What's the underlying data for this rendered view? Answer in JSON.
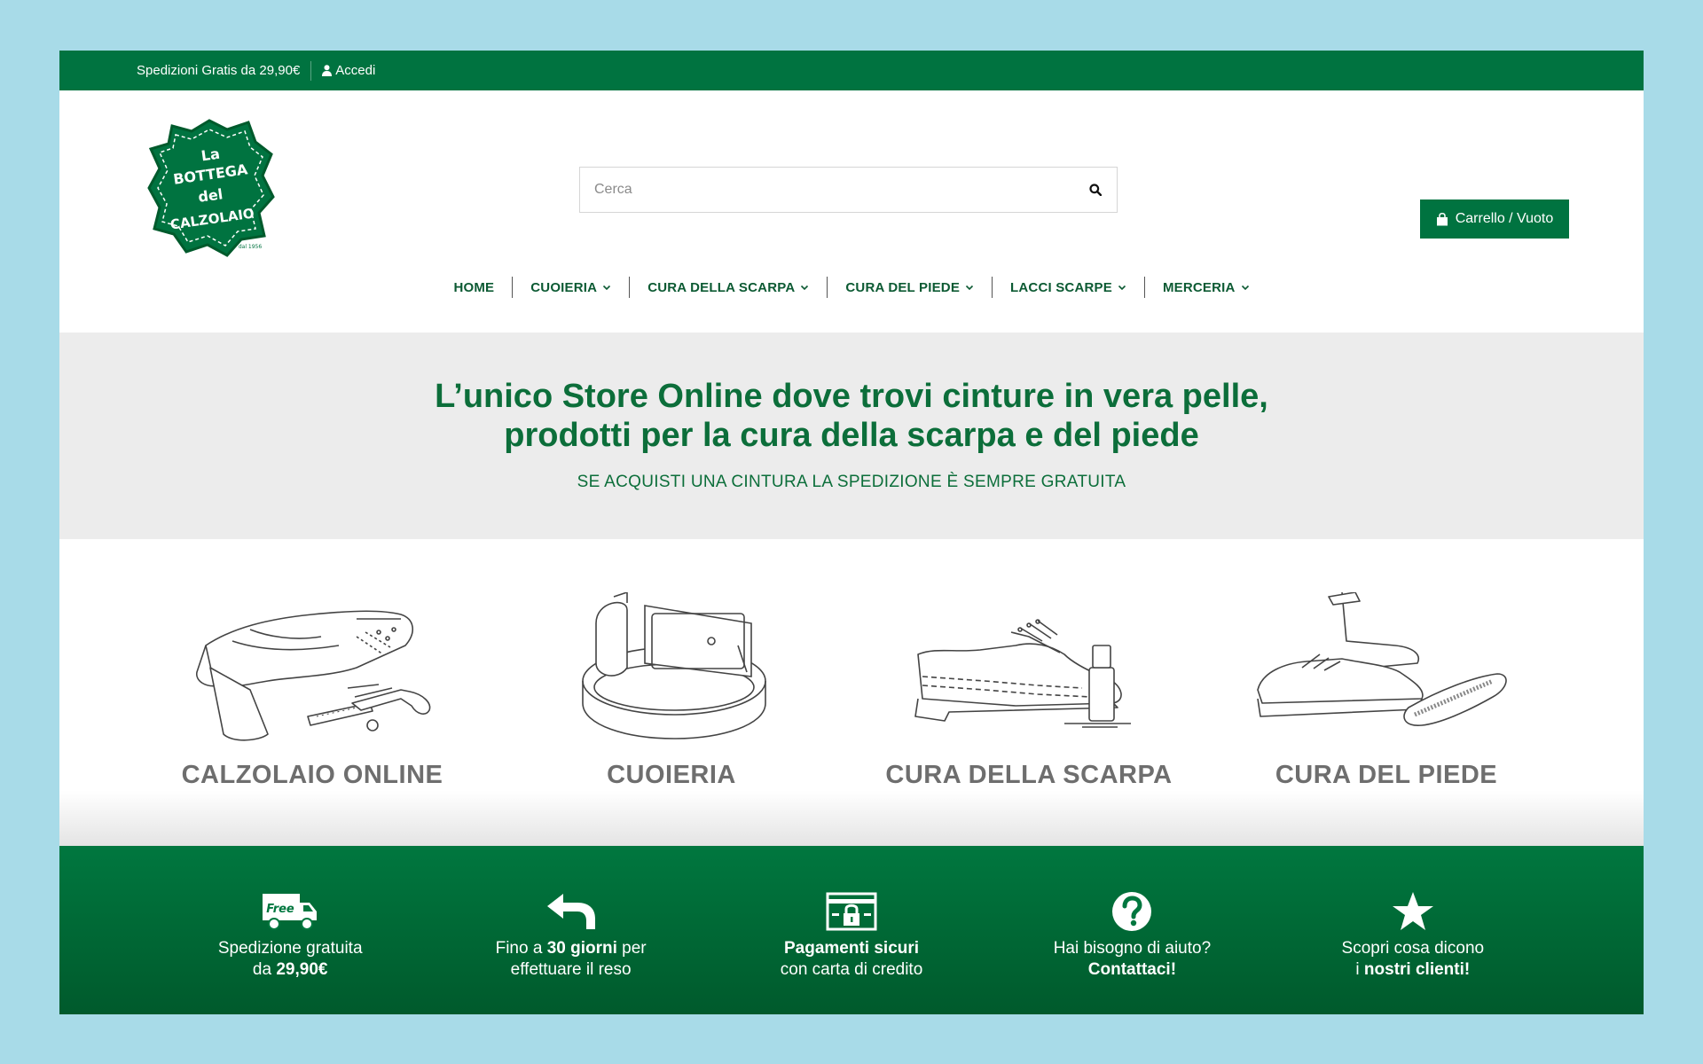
{
  "topbar": {
    "shipping_text": "Spedizioni Gratis da 29,90€",
    "login_label": "Accedi"
  },
  "logo": {
    "line1": "La",
    "line2": "BOTTEGA",
    "line3": "del",
    "line4": "CALZOLAIO",
    "since": "dal 1956",
    "brand_color": "#007340"
  },
  "search": {
    "placeholder": "Cerca"
  },
  "cart": {
    "label": "Carrello / Vuoto"
  },
  "nav": {
    "items": [
      {
        "label": "HOME",
        "dropdown": false
      },
      {
        "label": "CUOIERIA",
        "dropdown": true
      },
      {
        "label": "CURA DELLA SCARPA",
        "dropdown": true
      },
      {
        "label": "CURA DEL PIEDE",
        "dropdown": true
      },
      {
        "label": "LACCI SCARPE",
        "dropdown": true
      },
      {
        "label": "MERCERIA",
        "dropdown": true
      }
    ]
  },
  "hero": {
    "title_line1": "L’unico Store Online dove trovi cinture in vera pelle,",
    "title_line2": "prodotti per la cura della scarpa e del piede",
    "subtitle": "SE ACQUISTI UNA CINTURA LA SPEDIZIONE È SEMPRE GRATUITA"
  },
  "categories": [
    {
      "label": "CALZOLAIO ONLINE",
      "icon": "shoe-repair-icon"
    },
    {
      "label": "CUOIERIA",
      "icon": "belt-icon"
    },
    {
      "label": "CURA DELLA SCARPA",
      "icon": "shoe-care-icon"
    },
    {
      "label": "CURA DEL PIEDE",
      "icon": "foot-care-icon"
    }
  ],
  "features": {
    "shipping": {
      "badge": "Free",
      "line1": "Spedizione gratuita",
      "line2_pre": "da ",
      "line2_bold": "29,90€"
    },
    "returns": {
      "line1_pre": "Fino a ",
      "line1_bold": "30 giorni",
      "line1_post": " per",
      "line2": "effettuare il reso"
    },
    "payments": {
      "line1_bold": "Pagamenti sicuri",
      "line2": "con carta di credito"
    },
    "help": {
      "line1": "Hai bisogno di aiuto?",
      "line2_bold": "Contattaci!"
    },
    "reviews": {
      "line1": "Scopri cosa dicono",
      "line2_pre": "i ",
      "line2_bold": "nostri clienti!"
    }
  },
  "colors": {
    "accent": "#007340",
    "text_dark_green": "#0c5a33",
    "hero_bg": "#ececec",
    "page_bg": "#a8dbe8",
    "category_text": "#6e6e6e"
  }
}
